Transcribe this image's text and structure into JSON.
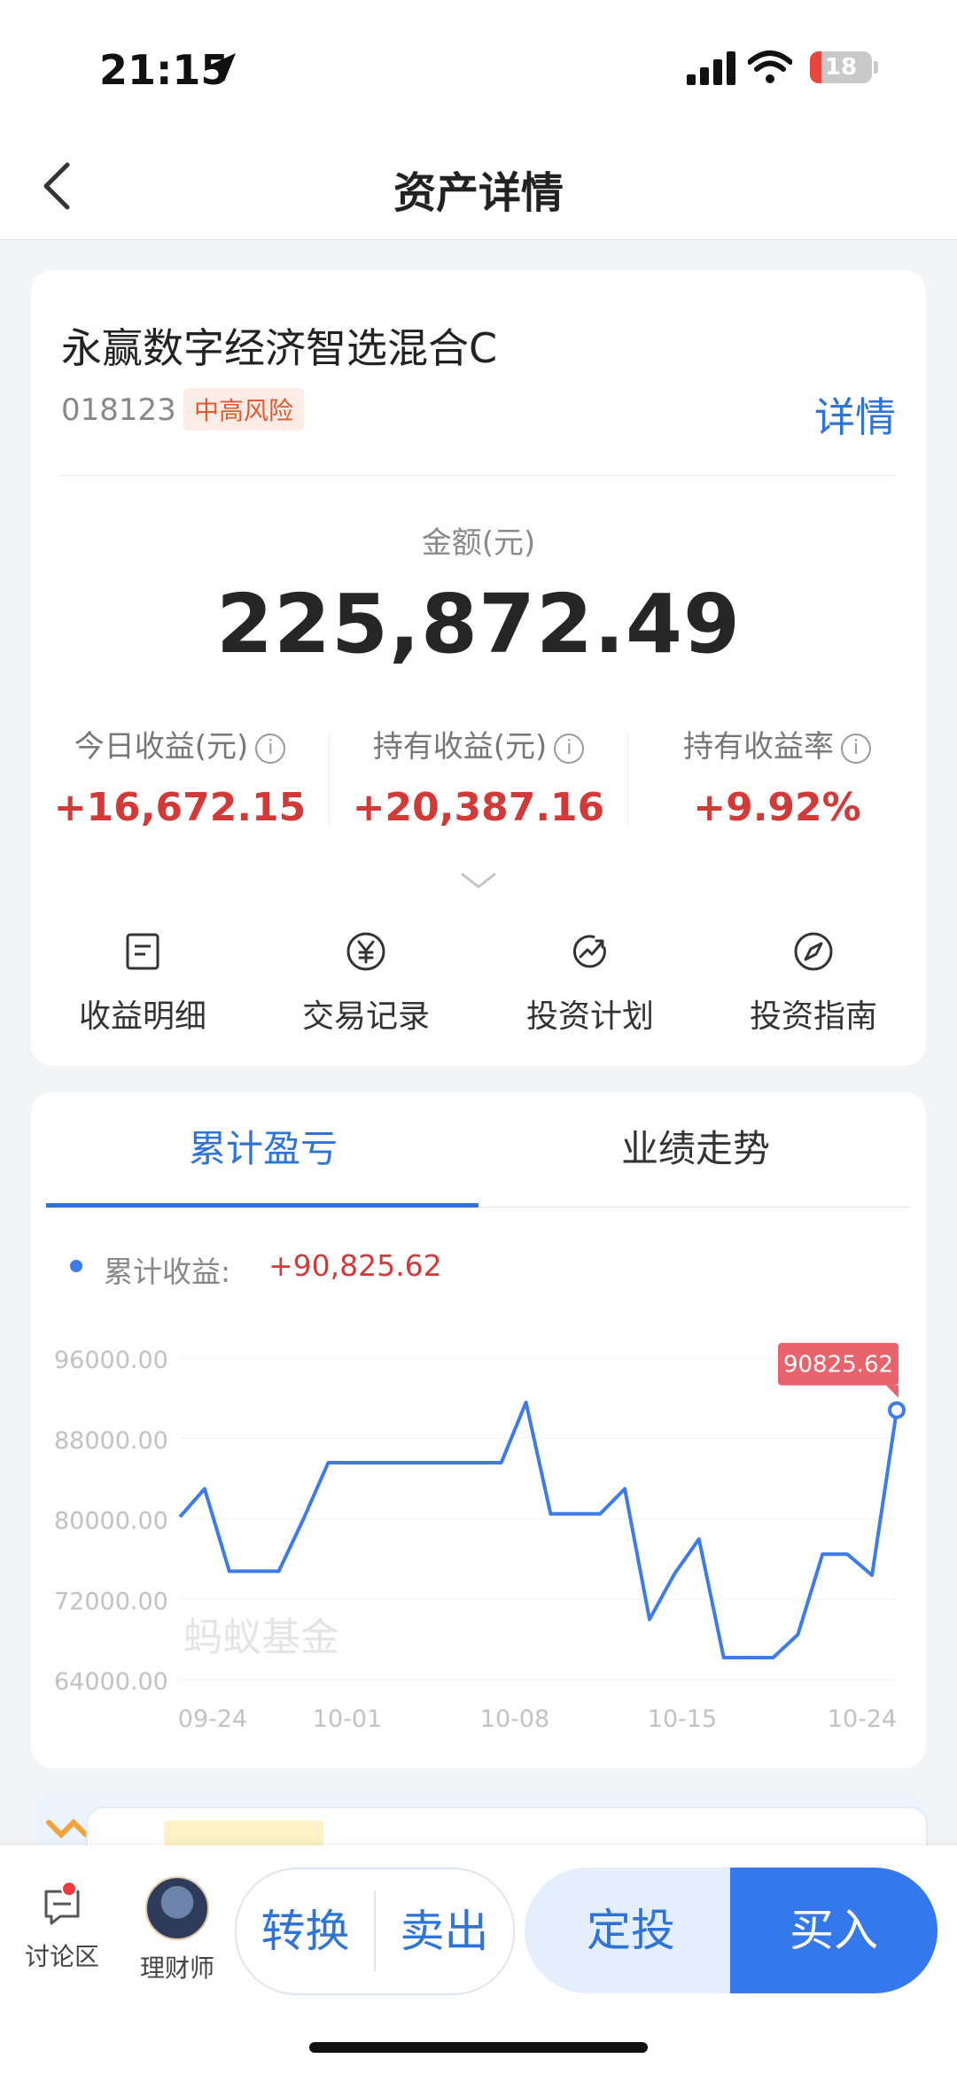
{
  "status_bar": {
    "time": "21:15",
    "battery": "18"
  },
  "nav": {
    "title": "资产详情"
  },
  "fund": {
    "name": "永赢数字经济智选混合C",
    "code": "018123",
    "risk": "中高风险",
    "detail_link": "详情",
    "amount_label": "金额(元)",
    "amount": "225,872.49",
    "stats": [
      {
        "label": "今日收益(元)",
        "value": "+16,672.15"
      },
      {
        "label": "持有收益(元)",
        "value": "+20,387.16"
      },
      {
        "label": "持有收益率",
        "value": "+9.92%"
      }
    ],
    "actions": [
      {
        "label": "收益明细",
        "icon": "document-icon"
      },
      {
        "label": "交易记录",
        "icon": "yen-icon"
      },
      {
        "label": "投资计划",
        "icon": "trend-icon"
      },
      {
        "label": "投资指南",
        "icon": "compass-icon"
      }
    ]
  },
  "chart_panel": {
    "tabs": [
      "累计盈亏",
      "业绩走势"
    ],
    "legend_label": "累计收益:",
    "legend_value": "+90,825.62",
    "watermark": "蚂蚁基金",
    "tooltip": "90825.62"
  },
  "chart_data": {
    "type": "line",
    "x_ticks": [
      "09-24",
      "10-01",
      "10-08",
      "10-15",
      "10-24"
    ],
    "y_ticks": [
      "96000.00",
      "88000.00",
      "80000.00",
      "72000.00",
      "64000.00"
    ],
    "ylim": [
      64000,
      96000
    ],
    "series": [
      {
        "values": [
          80200,
          83000,
          74800,
          74800,
          74800,
          80000,
          85600,
          85600,
          85600,
          85600,
          85600,
          85600,
          85600,
          85600,
          91600,
          80500,
          80500,
          80500,
          83000,
          70000,
          74500,
          78000,
          66200,
          66200,
          66200,
          68500,
          76500,
          76500,
          74400,
          90825.62
        ]
      }
    ],
    "last_point_label": "90825.62",
    "colors": {
      "line": "#3d7be8",
      "tooltip": "#e8636b"
    }
  },
  "bottom_bar": {
    "discussion": "讨论区",
    "advisor": "理财师",
    "convert": "转换",
    "sell": "卖出",
    "plan": "定投",
    "buy": "买入"
  }
}
